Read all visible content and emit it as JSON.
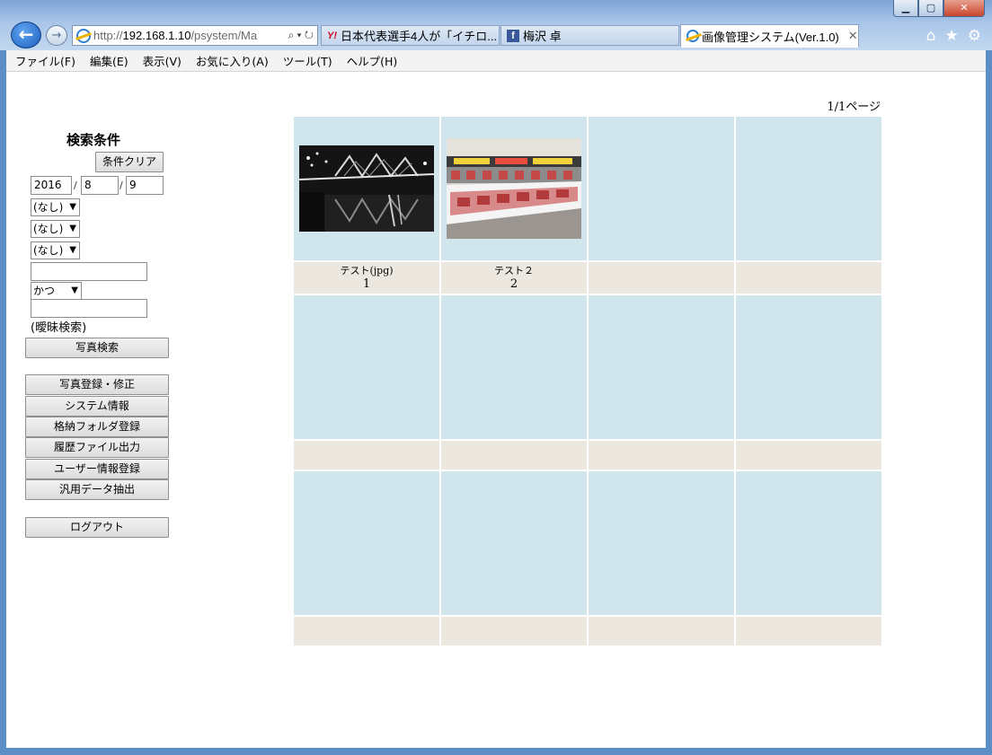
{
  "window": {
    "minimize": "▁",
    "maximize": "▢",
    "close": "✕"
  },
  "browser": {
    "address_prefix": "http://",
    "address_host": "192.168.1.10",
    "address_path": "/psystem/Ma",
    "address_tools": "⌕ ▾ ↻",
    "tabs": [
      {
        "label": "日本代表選手4人が「イチロ..."
      },
      {
        "label": "梅沢 卓"
      },
      {
        "label": "画像管理システム(Ver.1.0)"
      }
    ],
    "tab_close": "✕",
    "right_tools": [
      "⌂",
      "★",
      "⚙"
    ]
  },
  "menu": [
    "ファイル(F)",
    "編集(E)",
    "表示(V)",
    "お気に入り(A)",
    "ツール(T)",
    "ヘルプ(H)"
  ],
  "sidebar": {
    "title": "検索条件",
    "clear_button": "条件クリア",
    "date": {
      "year": "2016",
      "month": "8",
      "day": "9",
      "sep1": "/",
      "sep2": "/"
    },
    "selects": [
      "(なし)",
      "(なし)",
      "(なし)"
    ],
    "keyword1": "",
    "logic_select": "かつ",
    "keyword2": "",
    "fuzzy_note": "(曖昧検索)",
    "search_button": "写真検索",
    "menu_buttons": [
      "写真登録・修正",
      "システム情報",
      "格納フォルダ登録",
      "履歴ファイル出力",
      "ユーザー情報登録",
      "汎用データ抽出"
    ],
    "logout_button": "ログアウト"
  },
  "page_info": "1/1ページ",
  "photos": [
    {
      "title": "テスト(jpg)",
      "number": "1"
    },
    {
      "title": "テスト２",
      "number": "2"
    }
  ]
}
